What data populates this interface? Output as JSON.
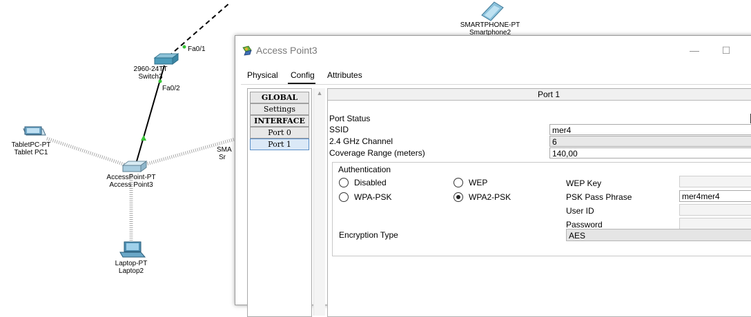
{
  "topology": {
    "switch": {
      "label_type": "2960-24TT",
      "label_name": "Switch3",
      "port_up": "Fa0/1",
      "port_down": "Fa0/2"
    },
    "tablet": {
      "label_type": "TabletPC-PT",
      "label_name": "Tablet PC1"
    },
    "access_point": {
      "label_type": "AccessPoint-PT",
      "label_name": "Access Point3"
    },
    "laptop": {
      "label_type": "Laptop-PT",
      "label_name": "Laptop2"
    },
    "smartphone": {
      "label_type": "SMARTPHONE-PT",
      "label_name": "Smartphone2"
    },
    "partial_device": {
      "label_type": "SMA",
      "label_name": "Sr"
    }
  },
  "window": {
    "title": "Access Point3",
    "minimize_glyph": "—",
    "maximize_glyph": "☐"
  },
  "tabs": [
    {
      "label": "Physical"
    },
    {
      "label": "Config"
    },
    {
      "label": "Attributes"
    }
  ],
  "nav": {
    "items": [
      {
        "label": "GLOBAL"
      },
      {
        "label": "Settings"
      },
      {
        "label": "INTERFACE"
      },
      {
        "label": "Port 0"
      },
      {
        "label": "Port 1"
      }
    ]
  },
  "panel": {
    "header": "Port 1",
    "port_status_label": "Port Status",
    "port_status_checked": "✓",
    "ssid_label": "SSID",
    "ssid_value": "mer4",
    "channel_label": "2.4 GHz Channel",
    "channel_value": "6",
    "coverage_label": "Coverage Range (meters)",
    "coverage_value": "140,00",
    "auth": {
      "title": "Authentication",
      "disabled_label": "Disabled",
      "wep_label": "WEP",
      "wpa_psk_label": "WPA-PSK",
      "wpa2_psk_label": "WPA2-PSK",
      "wep_key_label": "WEP Key",
      "wep_key_value": "",
      "psk_label": "PSK Pass Phrase",
      "psk_value": "mer4mer4",
      "user_id_label": "User ID",
      "user_id_value": "",
      "password_label": "Password",
      "password_value": "",
      "encryption_label": "Encryption Type",
      "encryption_value": "AES"
    }
  }
}
